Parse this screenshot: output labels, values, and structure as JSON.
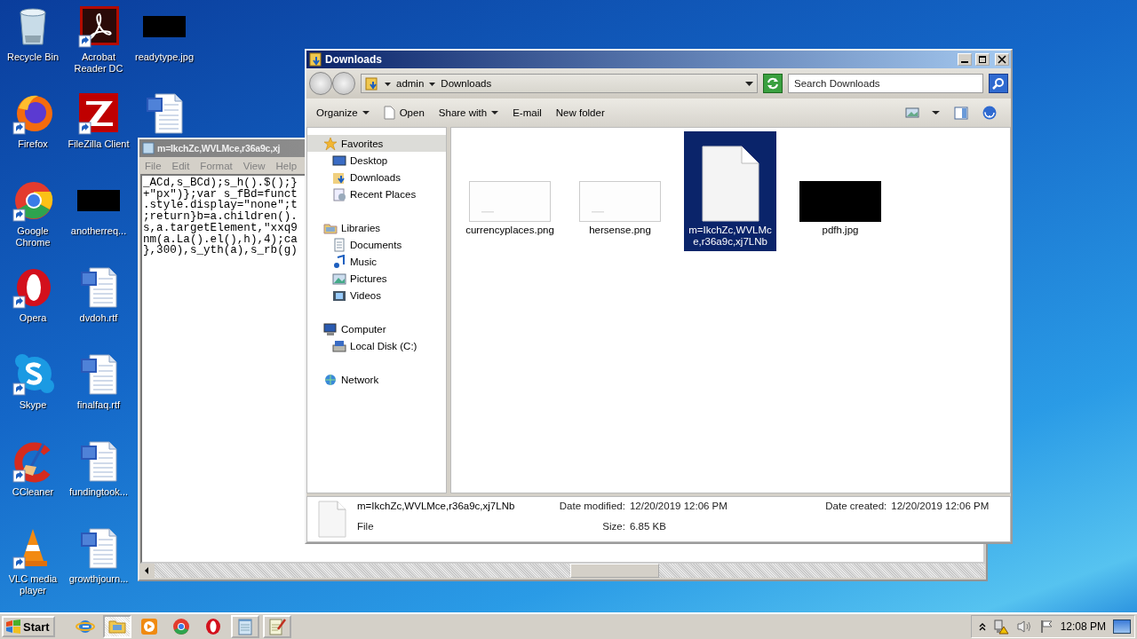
{
  "desktop": {
    "icons": [
      {
        "label": "Recycle Bin",
        "kind": "recycle",
        "shortcut": false
      },
      {
        "label": "Firefox",
        "kind": "firefox",
        "shortcut": true
      },
      {
        "label": "Google Chrome",
        "kind": "chrome",
        "shortcut": true
      },
      {
        "label": "Opera",
        "kind": "opera",
        "shortcut": true
      },
      {
        "label": "Skype",
        "kind": "skype",
        "shortcut": true
      },
      {
        "label": "CCleaner",
        "kind": "ccleaner",
        "shortcut": true
      },
      {
        "label": "VLC media player",
        "kind": "vlc",
        "shortcut": true
      },
      {
        "label": "Acrobat Reader DC",
        "kind": "acrobat",
        "shortcut": true
      },
      {
        "label": "FileZilla Client",
        "kind": "filezilla",
        "shortcut": true
      },
      {
        "label": "anotherreq...",
        "kind": "image",
        "shortcut": false
      },
      {
        "label": "dvdoh.rtf",
        "kind": "word",
        "shortcut": false
      },
      {
        "label": "finalfaq.rtf",
        "kind": "word",
        "shortcut": false
      },
      {
        "label": "fundingtook...",
        "kind": "word",
        "shortcut": false
      },
      {
        "label": "growthjourn...",
        "kind": "word",
        "shortcut": false
      },
      {
        "label": "readytype.jpg",
        "kind": "image",
        "shortcut": false
      },
      {
        "kind": "word",
        "shortcut": false
      }
    ]
  },
  "notepad": {
    "title": "m=IkchZc,WVLMce,r36a9c,xj",
    "menu": [
      "File",
      "Edit",
      "Format",
      "View",
      "Help"
    ],
    "lines": [
      "_ACd,s_BCd);s_h().$();}",
      "+\"px\")};var s_fBd=funct",
      ".style.display=\"none\";t",
      ";return}b=a.children().",
      "s,a.targetElement,\"xxq9",
      "nm(a.La().el(),h),4);ca",
      "},300),s_yth(a),s_rb(g)"
    ]
  },
  "explorer": {
    "title": "Downloads",
    "breadcrumb": [
      "admin",
      "Downloads"
    ],
    "search": {
      "placeholder": "Search Downloads"
    },
    "toolbar": [
      {
        "label": "Organize",
        "dropdown": true,
        "kind": "text"
      },
      {
        "label": "Open",
        "dropdown": false,
        "kind": "file"
      },
      {
        "label": "Share with",
        "dropdown": true,
        "kind": "text"
      },
      {
        "label": "E-mail",
        "dropdown": false,
        "kind": "text"
      },
      {
        "label": "New folder",
        "dropdown": false,
        "kind": "text"
      }
    ],
    "nav": [
      {
        "label": "Favorites",
        "kind": "star",
        "selected": true,
        "children": [
          {
            "label": "Desktop",
            "kind": "desktop",
            "selected": false
          },
          {
            "label": "Downloads",
            "kind": "downloads",
            "selected": false
          },
          {
            "label": "Recent Places",
            "kind": "recent",
            "selected": false
          }
        ]
      },
      {
        "label": "Libraries",
        "kind": "libraries",
        "selected": false,
        "children": [
          {
            "label": "Documents",
            "kind": "documents",
            "selected": false
          },
          {
            "label": "Music",
            "kind": "music",
            "selected": false
          },
          {
            "label": "Pictures",
            "kind": "pictures",
            "selected": false
          },
          {
            "label": "Videos",
            "kind": "videos",
            "selected": false
          }
        ]
      },
      {
        "label": "Computer",
        "kind": "computer",
        "selected": false,
        "children": [
          {
            "label": "Local Disk (C:)",
            "kind": "disk",
            "selected": false
          }
        ]
      },
      {
        "label": "Network",
        "kind": "network",
        "selected": false
      }
    ],
    "files": [
      {
        "name": "currencyplaces.png",
        "kind": "light",
        "selected": false
      },
      {
        "name": "hersense.png",
        "kind": "light",
        "selected": false
      },
      {
        "name": "m=IkchZc,WVLMce,r36a9c,xj7LNb",
        "kind": "file",
        "selected": true
      },
      {
        "name": "pdfh.jpg",
        "kind": "dark",
        "selected": false
      }
    ],
    "details": {
      "name": "m=IkchZc,WVLMce,r36a9c,xj7LNb",
      "type": "File",
      "fields": [
        {
          "label": "Date modified:",
          "value": "12/20/2019 12:06 PM"
        },
        {
          "label": "Date created:",
          "value": "12/20/2019 12:06 PM"
        },
        {
          "label": "Size:",
          "value": "6.85 KB"
        }
      ]
    }
  },
  "taskbar": {
    "start": "Start",
    "items": [
      {
        "kind": "ie",
        "selected": false,
        "open": false
      },
      {
        "kind": "folder",
        "selected": true,
        "open": true
      },
      {
        "kind": "media",
        "selected": false,
        "open": false
      },
      {
        "kind": "chrome",
        "selected": false,
        "open": false
      },
      {
        "kind": "opera",
        "selected": false,
        "open": false
      },
      {
        "kind": "notepad",
        "selected": false,
        "open": true
      },
      {
        "kind": "wordpad",
        "selected": false,
        "open": true
      }
    ],
    "clock": "12:08 PM"
  }
}
